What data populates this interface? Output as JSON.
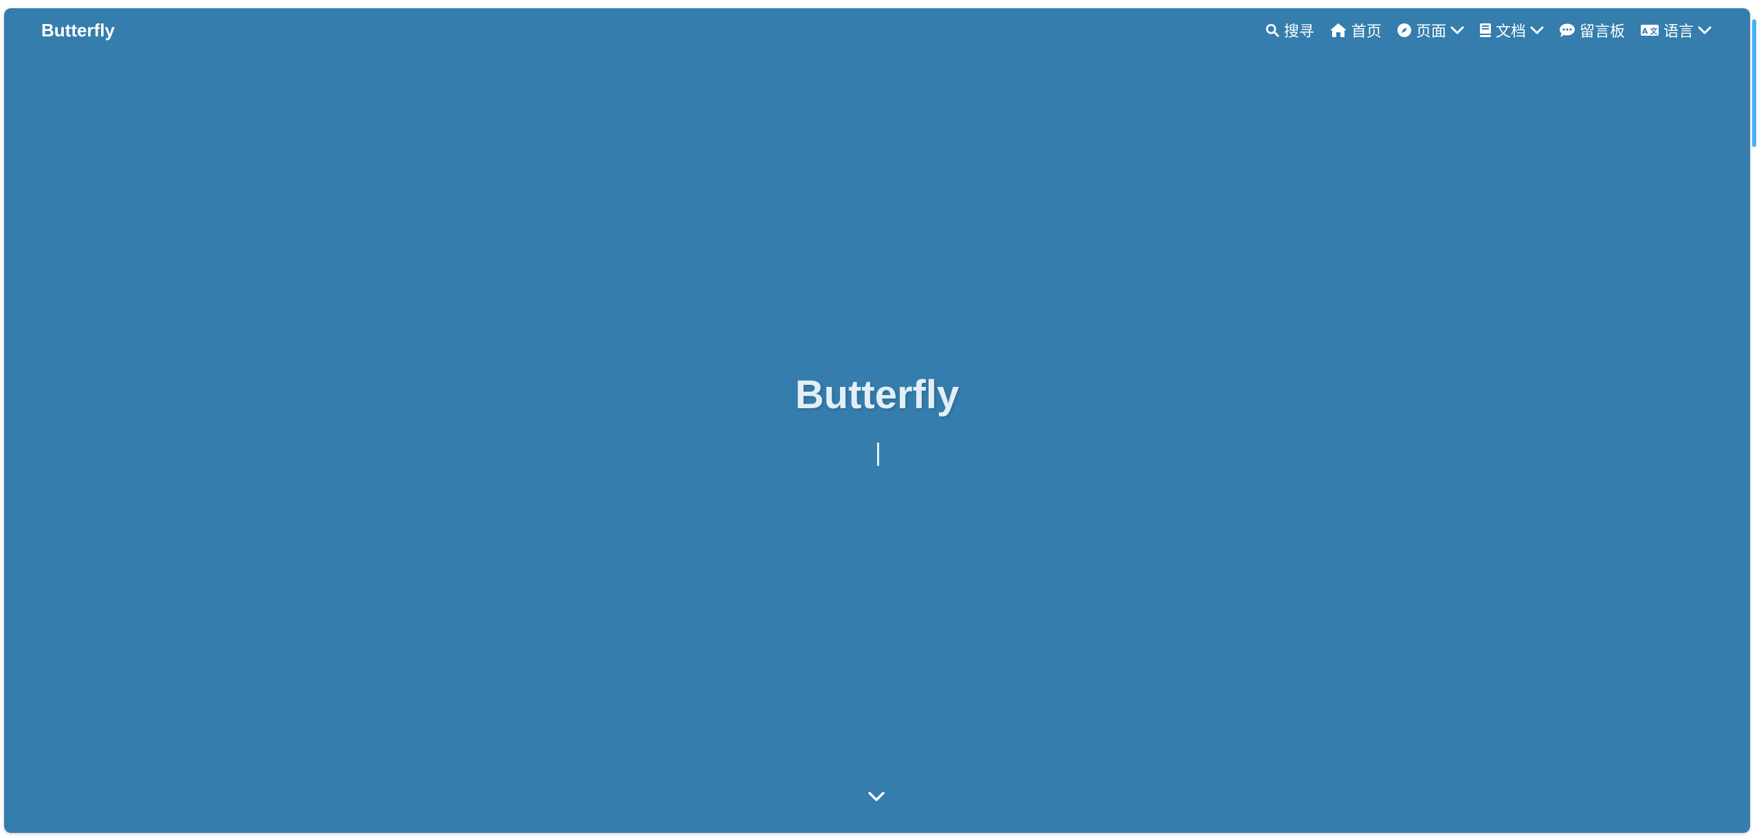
{
  "site": {
    "name": "Butterfly",
    "subtitle_cursor": "|"
  },
  "nav": {
    "items": [
      {
        "label": "搜寻",
        "icon": "search-icon",
        "has_dropdown": false
      },
      {
        "label": "首页",
        "icon": "home-icon",
        "has_dropdown": false
      },
      {
        "label": "页面",
        "icon": "compass-icon",
        "has_dropdown": true
      },
      {
        "label": "文档",
        "icon": "book-icon",
        "has_dropdown": true
      },
      {
        "label": "留言板",
        "icon": "comment-icon",
        "has_dropdown": false
      },
      {
        "label": "语言",
        "icon": "language-icon",
        "has_dropdown": true
      }
    ]
  },
  "hero": {
    "title": "Butterfly",
    "scroll_down_icon": "chevron-down-icon"
  },
  "colors": {
    "hero_background": "#357dad",
    "scrollbar": "#49b1f5",
    "text": "#ffffff"
  }
}
